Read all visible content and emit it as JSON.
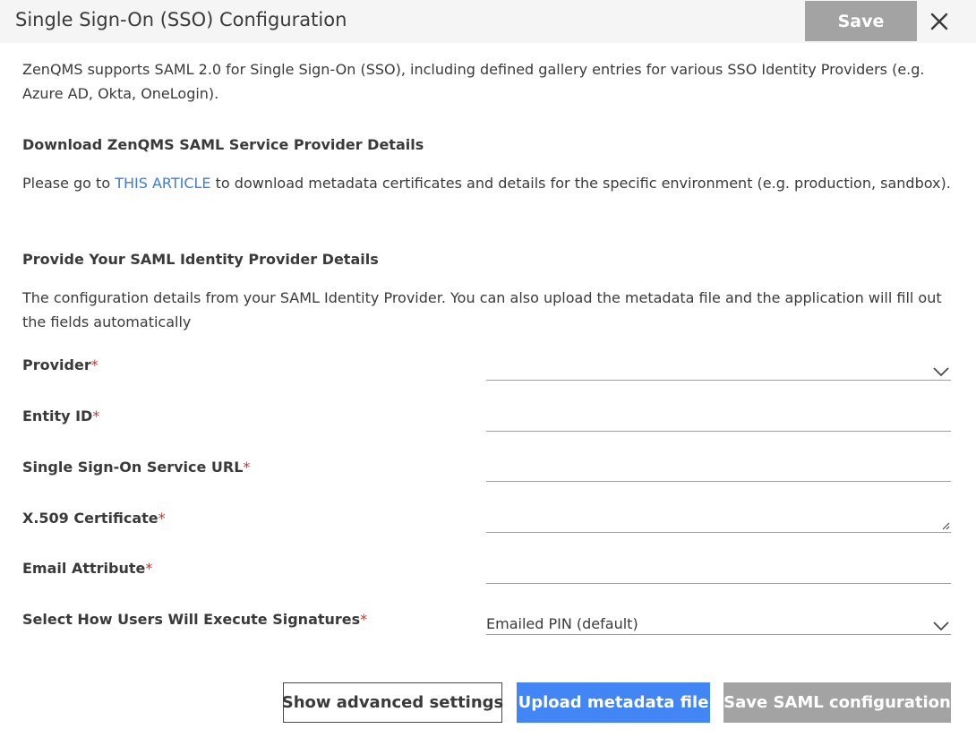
{
  "dialog": {
    "title": "Single Sign-On (SSO) Configuration",
    "save_label": "Save"
  },
  "intro": {
    "text": "ZenQMS supports SAML 2.0 for Single Sign-On (SSO), including defined gallery entries for various SSO Identity Providers (e.g. Azure AD, Okta, OneLogin)."
  },
  "download_section": {
    "title": "Download ZenQMS SAML Service Provider Details",
    "text_before": "Please go to ",
    "link_label": "THIS ARTICLE",
    "text_after": " to download metadata certificates and details for the specific environment (e.g. production, sandbox)."
  },
  "provide_section": {
    "title": "Provide Your SAML Identity Provider Details",
    "text": "The configuration details from your SAML Identity Provider. You can also upload the metadata file and the application will fill out the fields automatically"
  },
  "required_marker": "*",
  "fields": {
    "provider": {
      "label": "Provider",
      "value": ""
    },
    "entity_id": {
      "label": "Entity ID",
      "value": ""
    },
    "sso_url": {
      "label": "Single Sign-On Service URL",
      "value": ""
    },
    "certificate": {
      "label": "X.509 Certificate",
      "value": ""
    },
    "email_attribute": {
      "label": "Email Attribute",
      "value": ""
    },
    "signatures": {
      "label": "Select How Users Will Execute Signatures",
      "value": "Emailed PIN (default)"
    }
  },
  "buttons": {
    "advanced": "Show advanced settings",
    "upload": "Upload metadata file",
    "save_config": "Save SAML configuration"
  },
  "colors": {
    "link": "#3b7ddd",
    "primary": "#4285f4",
    "disabled": "#a3a3a3",
    "required": "#c0392b"
  },
  "icons": {
    "close": "close-icon",
    "dropdown": "chevron-down-icon",
    "resize": "resize-handle-icon"
  }
}
